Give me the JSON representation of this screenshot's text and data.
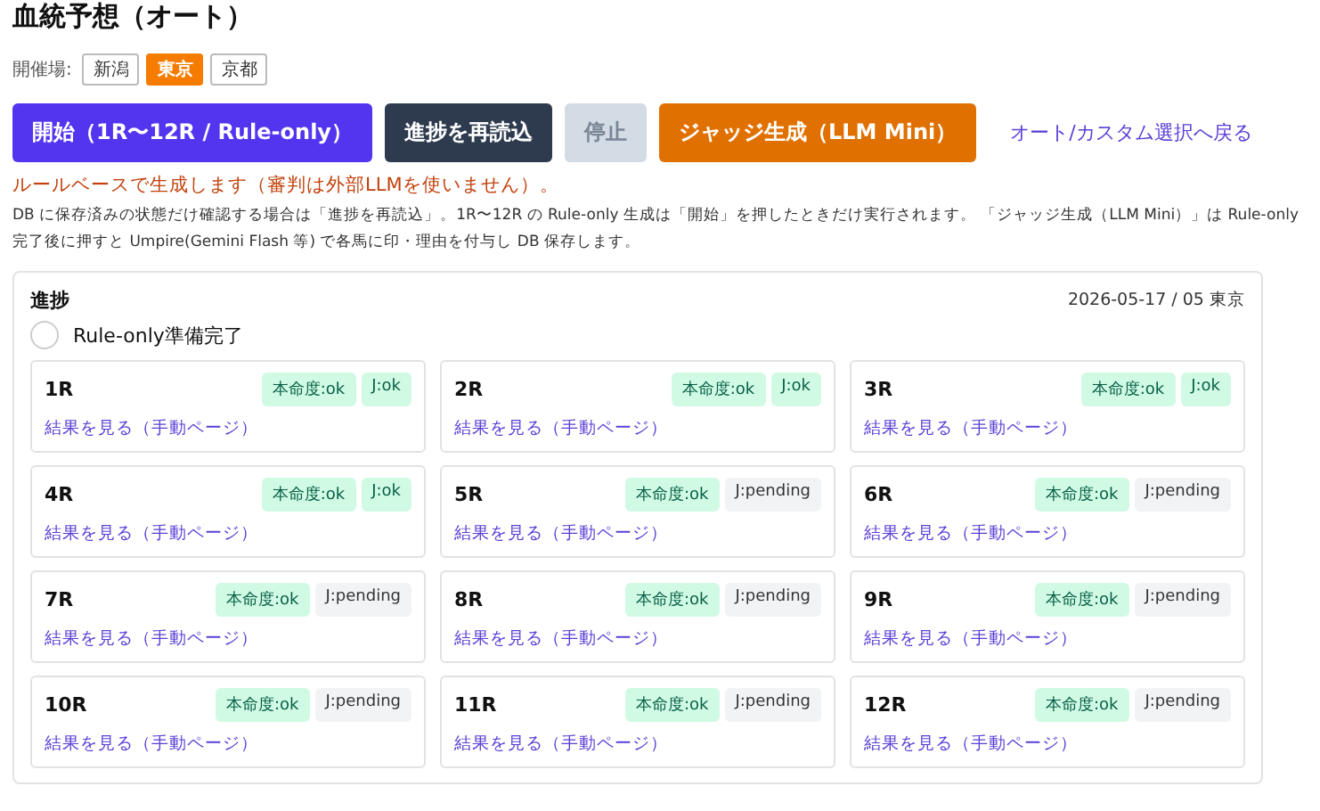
{
  "title": "血統予想（オート）",
  "venue": {
    "label": "開催場:",
    "options": [
      {
        "label": "新潟",
        "selected": false
      },
      {
        "label": "東京",
        "selected": true
      },
      {
        "label": "京都",
        "selected": false
      }
    ]
  },
  "actions": [
    {
      "label": "開始（1R〜12R / Rule-only）",
      "kind": "primary",
      "disabled": false
    },
    {
      "label": "進捗を再読込",
      "kind": "dark",
      "disabled": false
    },
    {
      "label": "停止",
      "kind": "dark",
      "disabled": true
    },
    {
      "label": "ジャッジ生成（LLM Mini）",
      "kind": "warn",
      "disabled": false
    },
    {
      "label": "オート/カスタム選択へ戻る",
      "kind": "link",
      "disabled": false
    }
  ],
  "notice": "ルールベースで生成します（審判は外部LLMを使いません）。",
  "description": "DB に保存済みの状態だけ確認する場合は「進捗を再読込」。1R〜12R の Rule-only 生成は「開始」を押したときだけ実行されます。 「ジャッジ生成（LLM Mini）」は Rule-only 完了後に押すと Umpire(Gemini Flash 等) で各馬に印・理由を付与し DB 保存します。",
  "progress": {
    "title": "進捗",
    "meta": "2026-05-17 / 05 東京",
    "status": {
      "label": "Rule-only準備完了",
      "done": false
    },
    "races": [
      {
        "name": "1R",
        "link": "結果を見る（手動ページ）",
        "badges": [
          {
            "label": "本命度:ok",
            "kind": "ok"
          },
          {
            "label": "J:ok",
            "kind": "ok"
          }
        ]
      },
      {
        "name": "2R",
        "link": "結果を見る（手動ページ）",
        "badges": [
          {
            "label": "本命度:ok",
            "kind": "ok"
          },
          {
            "label": "J:ok",
            "kind": "ok"
          }
        ]
      },
      {
        "name": "3R",
        "link": "結果を見る（手動ページ）",
        "badges": [
          {
            "label": "本命度:ok",
            "kind": "ok"
          },
          {
            "label": "J:ok",
            "kind": "ok"
          }
        ]
      },
      {
        "name": "4R",
        "link": "結果を見る（手動ページ）",
        "badges": [
          {
            "label": "本命度:ok",
            "kind": "ok"
          },
          {
            "label": "J:ok",
            "kind": "ok"
          }
        ]
      },
      {
        "name": "5R",
        "link": "結果を見る（手動ページ）",
        "badges": [
          {
            "label": "本命度:ok",
            "kind": "ok"
          },
          {
            "label": "J:pending",
            "kind": "pending"
          }
        ]
      },
      {
        "name": "6R",
        "link": "結果を見る（手動ページ）",
        "badges": [
          {
            "label": "本命度:ok",
            "kind": "ok"
          },
          {
            "label": "J:pending",
            "kind": "pending"
          }
        ]
      },
      {
        "name": "7R",
        "link": "結果を見る（手動ページ）",
        "badges": [
          {
            "label": "本命度:ok",
            "kind": "ok"
          },
          {
            "label": "J:pending",
            "kind": "pending"
          }
        ]
      },
      {
        "name": "8R",
        "link": "結果を見る（手動ページ）",
        "badges": [
          {
            "label": "本命度:ok",
            "kind": "ok"
          },
          {
            "label": "J:pending",
            "kind": "pending"
          }
        ]
      },
      {
        "name": "9R",
        "link": "結果を見る（手動ページ）",
        "badges": [
          {
            "label": "本命度:ok",
            "kind": "ok"
          },
          {
            "label": "J:pending",
            "kind": "pending"
          }
        ]
      },
      {
        "name": "10R",
        "link": "結果を見る（手動ページ）",
        "badges": [
          {
            "label": "本命度:ok",
            "kind": "ok"
          },
          {
            "label": "J:pending",
            "kind": "pending"
          }
        ]
      },
      {
        "name": "11R",
        "link": "結果を見る（手動ページ）",
        "badges": [
          {
            "label": "本命度:ok",
            "kind": "ok"
          },
          {
            "label": "J:pending",
            "kind": "pending"
          }
        ]
      },
      {
        "name": "12R",
        "link": "結果を見る（手動ページ）",
        "badges": [
          {
            "label": "本命度:ok",
            "kind": "ok"
          },
          {
            "label": "J:pending",
            "kind": "pending"
          }
        ]
      }
    ]
  }
}
